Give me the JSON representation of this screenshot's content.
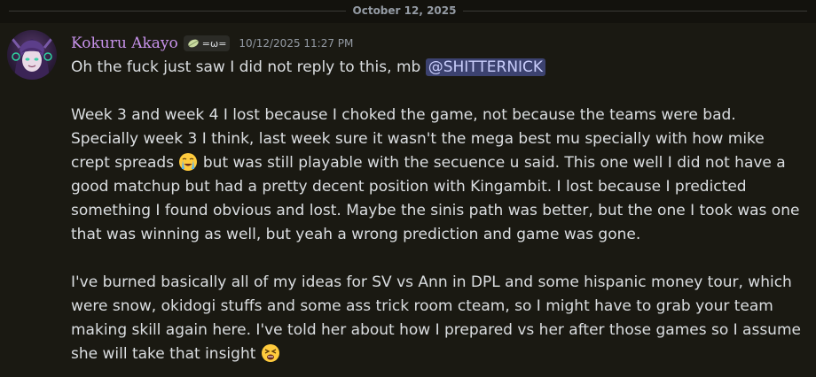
{
  "date_divider": "October 12, 2025",
  "message": {
    "author": "Kokuru Akayo",
    "tag_label": "=ω=",
    "tag_icon": "leaf-icon",
    "timestamp": "10/12/2025 11:27 PM",
    "line1": "Oh the fuck just saw I did not reply to this, mb ",
    "mention": "@SHITTERNICK",
    "para2_part1": "Week 3 and week 4 I lost because I choked the game, not because the teams were bad. Specially week 3 I think, last week sure it wasn't the mega best mu specially with how mike crept spreads ",
    "emoji1": "loudly-crying-face",
    "para2_part2": " but was still playable with the secuence u said. This one well I did not have a good matchup but had a pretty decent position with Kingambit. I lost because I predicted something I found obvious and lost. Maybe the sinis path was better, but the one I took was one that was winning as well, but yeah a wrong prediction and game was gone.",
    "para3": "I've burned basically all of my ideas for SV vs Ann in DPL and some hispanic money tour, which were snow, okidogi stuffs and some ass trick room cteam, so I might have to grab your team making skill again here. I've told her about how I prepared vs her after those games so I assume she will take that insight ",
    "emoji2": "weary-face"
  },
  "colors": {
    "background": "#13120d",
    "message_background": "#1a1912",
    "username": "#c792ea",
    "mention_bg": "#3c4270",
    "mention_text": "#c9cdfb",
    "muted": "#949ba4"
  }
}
